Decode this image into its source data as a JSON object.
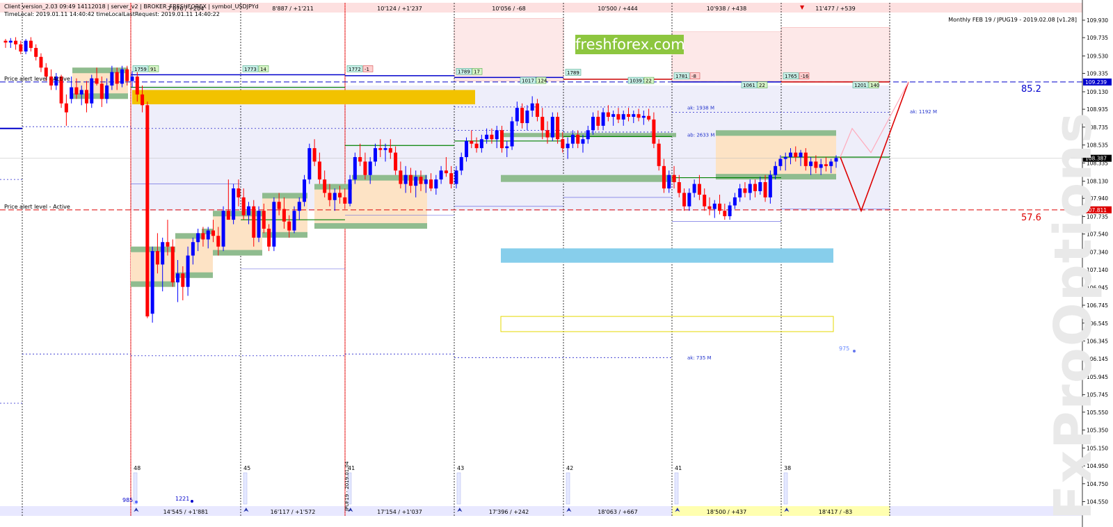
{
  "header": {
    "line1": "Client version_2.03 09:49 14112018 | server_v2 | BROKER_FRESHFOREX | symbol_USDJPYd",
    "line2": "TimeLocal: 2019.01.11 14:40:42 timeLocalLastRequest: 2019.01.11 14:40:22",
    "title": "Monthly FEB 19 / JPUG19 - 2019.02.08 [v1.28]"
  },
  "brand": "freshforex.com",
  "watermark": "FxProOptions",
  "colors": {
    "bull": "#0000ff",
    "bear": "#ff0000",
    "orange_zone": "#fde3c5",
    "green_zone": "#8fbc8f",
    "gold_bar": "#f2c200",
    "sky_bar": "#87ceeb",
    "pink_zone": "#fde8e8",
    "lavender_zone": "#eeeefa"
  },
  "chart_data": {
    "type": "candlestick",
    "symbol": "USDJPY",
    "ylim": [
      104.5,
      110.0
    ],
    "y_ticks": [
      "109.930",
      "109.735",
      "109.530",
      "109.335",
      "109.130",
      "108.935",
      "108.735",
      "108.535",
      "108.335",
      "108.130",
      "107.940",
      "107.735",
      "107.540",
      "107.340",
      "107.140",
      "106.945",
      "106.745",
      "106.545",
      "106.345",
      "106.145",
      "105.945",
      "105.745",
      "105.550",
      "105.350",
      "105.150",
      "104.950",
      "104.750",
      "104.550"
    ],
    "price_tags": [
      {
        "label": "109.239",
        "color": "#0000cc"
      },
      {
        "label": "108.387",
        "color": "#000000"
      },
      {
        "label": "107.811",
        "color": "#dd0000"
      }
    ],
    "alerts": [
      {
        "text": "Price alert level - Active",
        "price": 109.24,
        "color": "#0000cc"
      },
      {
        "text": "Price alert level - Active",
        "price": 107.81,
        "color": "#dd0000"
      }
    ],
    "level_values": [
      {
        "text": "85.2",
        "price": 109.17,
        "color": "#0000cc"
      },
      {
        "text": "57.6",
        "price": 107.73,
        "color": "#dd0000"
      }
    ],
    "top_labels": [
      "7'676 / +204",
      "8'887 / +1'211",
      "10'124 / +1'237",
      "10'056 / -68",
      "10'500 / +444",
      "10'938 / +438",
      "11'477 / +539"
    ],
    "bottom_labels": [
      "14'545 / +1'881",
      "16'117 / +1'572",
      "17'154 / +1'037",
      "17'396 / +242",
      "18'063 / +667",
      "18'500 / +437",
      "18'417 / -83"
    ],
    "volume_labels": [
      "48",
      "45",
      "41",
      "43",
      "42",
      "41",
      "38"
    ],
    "misc_labels": [
      "985",
      "1221",
      "975",
      "JPUF19 - 2019.01.04"
    ],
    "badges": [
      {
        "a": "1759",
        "b": "91"
      },
      {
        "a": "1773",
        "b": "14"
      },
      {
        "a": "1772",
        "b": "-1"
      },
      {
        "a": "1789",
        "b": "17"
      },
      {
        "a": "1017",
        "b": "124"
      },
      {
        "a": "1789",
        "b": ""
      },
      {
        "a": "1039",
        "b": "22"
      },
      {
        "a": "1781",
        "b": "-8"
      },
      {
        "a": "1061",
        "b": "22"
      },
      {
        "a": "1765",
        "b": "-16"
      },
      {
        "a": "1201",
        "b": "140"
      }
    ],
    "annotations": [
      "ak: 1938 M",
      "ab: 2633 M",
      "ak: 1192 M",
      "ak: 735 M"
    ],
    "candles": [
      [
        109.7,
        109.72,
        109.62,
        109.68
      ],
      [
        109.68,
        109.73,
        109.62,
        109.7
      ],
      [
        109.7,
        109.74,
        109.6,
        109.66
      ],
      [
        109.66,
        109.7,
        109.55,
        109.58
      ],
      [
        109.58,
        109.72,
        109.55,
        109.7
      ],
      [
        109.7,
        109.74,
        109.58,
        109.62
      ],
      [
        109.62,
        109.66,
        109.48,
        109.52
      ],
      [
        109.52,
        109.56,
        109.35,
        109.4
      ],
      [
        109.4,
        109.45,
        109.25,
        109.3
      ],
      [
        109.3,
        109.38,
        109.15,
        109.2
      ],
      [
        109.2,
        109.34,
        109.15,
        109.3
      ],
      [
        109.3,
        109.32,
        108.95,
        109.0
      ],
      [
        109.0,
        109.1,
        108.75,
        108.9
      ],
      [
        109.05,
        109.3,
        109.0,
        109.18
      ],
      [
        109.18,
        109.28,
        109.05,
        109.1
      ],
      [
        109.1,
        109.2,
        108.98,
        109.15
      ],
      [
        109.15,
        109.25,
        108.9,
        109.0
      ],
      [
        109.0,
        109.32,
        108.95,
        109.28
      ],
      [
        109.28,
        109.4,
        109.2,
        109.22
      ],
      [
        109.22,
        109.3,
        108.96,
        109.05
      ],
      [
        109.05,
        109.28,
        109.0,
        109.2
      ],
      [
        109.2,
        109.42,
        109.15,
        109.35
      ],
      [
        109.35,
        109.4,
        109.15,
        109.22
      ],
      [
        109.22,
        109.42,
        109.18,
        109.38
      ],
      [
        109.38,
        109.42,
        109.2,
        109.25
      ],
      [
        109.25,
        109.36,
        109.18,
        109.3
      ],
      [
        109.3,
        109.35,
        109.02,
        109.1
      ],
      [
        109.1,
        109.2,
        108.9,
        108.98
      ],
      [
        108.98,
        109.02,
        106.6,
        106.62
      ],
      [
        106.65,
        107.4,
        106.55,
        107.35
      ],
      [
        107.35,
        107.55,
        107.1,
        107.2
      ],
      [
        107.2,
        107.5,
        106.9,
        107.45
      ],
      [
        107.45,
        107.7,
        107.3,
        107.4
      ],
      [
        107.4,
        107.48,
        106.95,
        107.0
      ],
      [
        107.0,
        107.25,
        106.78,
        107.1
      ],
      [
        107.1,
        107.18,
        106.8,
        106.95
      ],
      [
        106.95,
        107.4,
        106.85,
        107.3
      ],
      [
        107.3,
        107.5,
        107.2,
        107.45
      ],
      [
        107.45,
        107.6,
        107.35,
        107.55
      ],
      [
        107.55,
        107.62,
        107.4,
        107.48
      ],
      [
        107.48,
        107.62,
        107.38,
        107.58
      ],
      [
        107.58,
        107.7,
        107.45,
        107.52
      ],
      [
        107.52,
        107.62,
        107.3,
        107.4
      ],
      [
        107.4,
        107.85,
        107.35,
        107.8
      ],
      [
        107.8,
        108.15,
        107.7,
        107.7
      ],
      [
        107.7,
        108.1,
        107.65,
        108.05
      ],
      [
        108.05,
        108.15,
        107.85,
        107.95
      ],
      [
        107.95,
        108.05,
        107.7,
        107.75
      ],
      [
        107.75,
        107.9,
        107.65,
        107.85
      ],
      [
        107.85,
        107.92,
        107.4,
        107.5
      ],
      [
        107.5,
        107.85,
        107.45,
        107.8
      ],
      [
        107.8,
        107.88,
        107.55,
        107.6
      ],
      [
        107.6,
        107.65,
        107.35,
        107.4
      ],
      [
        107.4,
        107.95,
        107.35,
        107.9
      ],
      [
        107.9,
        108.0,
        107.75,
        107.82
      ],
      [
        107.82,
        107.95,
        107.6,
        107.68
      ],
      [
        107.68,
        107.75,
        107.5,
        107.58
      ],
      [
        107.58,
        107.85,
        107.55,
        107.8
      ],
      [
        107.8,
        107.95,
        107.7,
        107.9
      ],
      [
        107.9,
        108.2,
        107.85,
        108.15
      ],
      [
        108.15,
        108.55,
        108.1,
        108.5
      ],
      [
        108.5,
        108.6,
        108.3,
        108.35
      ],
      [
        108.35,
        108.45,
        108.1,
        108.15
      ],
      [
        108.15,
        108.25,
        107.95,
        108.0
      ],
      [
        108.0,
        108.1,
        107.85,
        107.92
      ],
      [
        107.92,
        108.05,
        107.8,
        108.0
      ],
      [
        108.0,
        108.08,
        107.88,
        107.95
      ],
      [
        107.95,
        108.05,
        107.82,
        107.88
      ],
      [
        107.88,
        108.2,
        107.85,
        108.15
      ],
      [
        108.15,
        108.45,
        108.1,
        108.4
      ],
      [
        108.4,
        108.55,
        108.3,
        108.35
      ],
      [
        108.35,
        108.45,
        108.15,
        108.2
      ],
      [
        108.2,
        108.4,
        108.1,
        108.35
      ],
      [
        108.35,
        108.55,
        108.3,
        108.5
      ],
      [
        108.5,
        108.6,
        108.4,
        108.48
      ],
      [
        108.48,
        108.55,
        108.35,
        108.5
      ],
      [
        108.5,
        108.6,
        108.38,
        108.45
      ],
      [
        108.45,
        108.52,
        108.2,
        108.25
      ],
      [
        108.25,
        108.35,
        108.05,
        108.1
      ],
      [
        108.1,
        108.3,
        108.0,
        108.2
      ],
      [
        108.2,
        108.28,
        108.0,
        108.08
      ],
      [
        108.08,
        108.25,
        107.95,
        108.18
      ],
      [
        108.18,
        108.25,
        108.02,
        108.1
      ],
      [
        108.1,
        108.2,
        108.0,
        108.15
      ],
      [
        108.15,
        108.22,
        108.02,
        108.05
      ],
      [
        108.05,
        108.2,
        107.98,
        108.15
      ],
      [
        108.15,
        108.3,
        108.1,
        108.25
      ],
      [
        108.25,
        108.4,
        108.18,
        108.22
      ],
      [
        108.22,
        108.3,
        108.05,
        108.1
      ],
      [
        108.1,
        108.3,
        108.05,
        108.25
      ],
      [
        108.25,
        108.45,
        108.2,
        108.4
      ],
      [
        108.4,
        108.62,
        108.35,
        108.58
      ],
      [
        108.58,
        108.7,
        108.5,
        108.55
      ],
      [
        108.55,
        108.62,
        108.45,
        108.5
      ],
      [
        108.5,
        108.65,
        108.45,
        108.6
      ],
      [
        108.6,
        108.72,
        108.55,
        108.65
      ],
      [
        108.65,
        108.72,
        108.55,
        108.6
      ],
      [
        108.6,
        108.75,
        108.5,
        108.7
      ],
      [
        108.7,
        108.75,
        108.45,
        108.5
      ],
      [
        108.5,
        108.58,
        108.4,
        108.52
      ],
      [
        108.52,
        108.85,
        108.48,
        108.8
      ],
      [
        108.8,
        109.02,
        108.75,
        108.95
      ],
      [
        108.95,
        109.0,
        108.72,
        108.78
      ],
      [
        108.78,
        108.98,
        108.7,
        108.92
      ],
      [
        108.92,
        109.08,
        108.85,
        109.0
      ],
      [
        109.0,
        109.05,
        108.8,
        108.85
      ],
      [
        108.85,
        108.95,
        108.6,
        108.7
      ],
      [
        108.7,
        108.8,
        108.55,
        108.62
      ],
      [
        108.62,
        108.9,
        108.58,
        108.85
      ],
      [
        108.85,
        108.9,
        108.55,
        108.6
      ],
      [
        108.6,
        108.68,
        108.45,
        108.5
      ],
      [
        108.5,
        108.62,
        108.38,
        108.55
      ],
      [
        108.55,
        108.7,
        108.5,
        108.65
      ],
      [
        108.65,
        108.7,
        108.5,
        108.55
      ],
      [
        108.55,
        108.65,
        108.45,
        108.6
      ],
      [
        108.6,
        108.75,
        108.55,
        108.7
      ],
      [
        108.7,
        108.9,
        108.65,
        108.85
      ],
      [
        108.85,
        108.92,
        108.7,
        108.75
      ],
      [
        108.75,
        108.95,
        108.7,
        108.9
      ],
      [
        108.9,
        108.98,
        108.8,
        108.85
      ],
      [
        108.85,
        108.92,
        108.75,
        108.88
      ],
      [
        108.88,
        108.95,
        108.78,
        108.82
      ],
      [
        108.82,
        108.92,
        108.75,
        108.88
      ],
      [
        108.88,
        108.95,
        108.8,
        108.85
      ],
      [
        108.85,
        108.92,
        108.78,
        108.88
      ],
      [
        108.88,
        108.94,
        108.8,
        108.84
      ],
      [
        108.84,
        108.92,
        108.76,
        108.86
      ],
      [
        108.86,
        108.94,
        108.8,
        108.82
      ],
      [
        108.82,
        108.9,
        108.5,
        108.55
      ],
      [
        108.55,
        108.6,
        108.25,
        108.3
      ],
      [
        108.3,
        108.38,
        108.0,
        108.05
      ],
      [
        108.05,
        108.25,
        108.0,
        108.2
      ],
      [
        108.2,
        108.3,
        108.05,
        108.12
      ],
      [
        108.12,
        108.2,
        107.95,
        108.0
      ],
      [
        108.0,
        108.05,
        107.8,
        107.85
      ],
      [
        107.85,
        108.05,
        107.8,
        108.0
      ],
      [
        108.0,
        108.15,
        107.95,
        108.1
      ],
      [
        108.1,
        108.2,
        107.92,
        107.98
      ],
      [
        107.98,
        108.05,
        107.8,
        107.85
      ],
      [
        107.85,
        107.95,
        107.75,
        107.82
      ],
      [
        107.82,
        107.92,
        107.72,
        107.88
      ],
      [
        107.88,
        107.98,
        107.76,
        107.8
      ],
      [
        107.8,
        107.88,
        107.7,
        107.74
      ],
      [
        107.74,
        107.9,
        107.7,
        107.86
      ],
      [
        107.86,
        108.0,
        107.82,
        107.95
      ],
      [
        107.95,
        108.1,
        107.9,
        108.05
      ],
      [
        108.05,
        108.12,
        107.95,
        108.0
      ],
      [
        108.0,
        108.15,
        107.92,
        108.1
      ],
      [
        108.1,
        108.15,
        107.95,
        108.02
      ],
      [
        108.02,
        108.18,
        107.98,
        108.12
      ],
      [
        108.12,
        108.2,
        107.9,
        107.95
      ],
      [
        107.95,
        108.25,
        107.88,
        108.2
      ],
      [
        108.2,
        108.35,
        108.15,
        108.3
      ],
      [
        108.3,
        108.42,
        108.25,
        108.38
      ],
      [
        108.38,
        108.45,
        108.25,
        108.4
      ],
      [
        108.4,
        108.5,
        108.32,
        108.45
      ],
      [
        108.45,
        108.52,
        108.35,
        108.4
      ],
      [
        108.4,
        108.48,
        108.3,
        108.45
      ],
      [
        108.45,
        108.5,
        108.25,
        108.3
      ],
      [
        108.3,
        108.4,
        108.2,
        108.35
      ],
      [
        108.35,
        108.42,
        108.22,
        108.28
      ],
      [
        108.28,
        108.38,
        108.2,
        108.32
      ],
      [
        108.32,
        108.4,
        108.24,
        108.3
      ],
      [
        108.3,
        108.38,
        108.22,
        108.35
      ],
      [
        108.35,
        108.42,
        108.28,
        108.39
      ]
    ]
  }
}
